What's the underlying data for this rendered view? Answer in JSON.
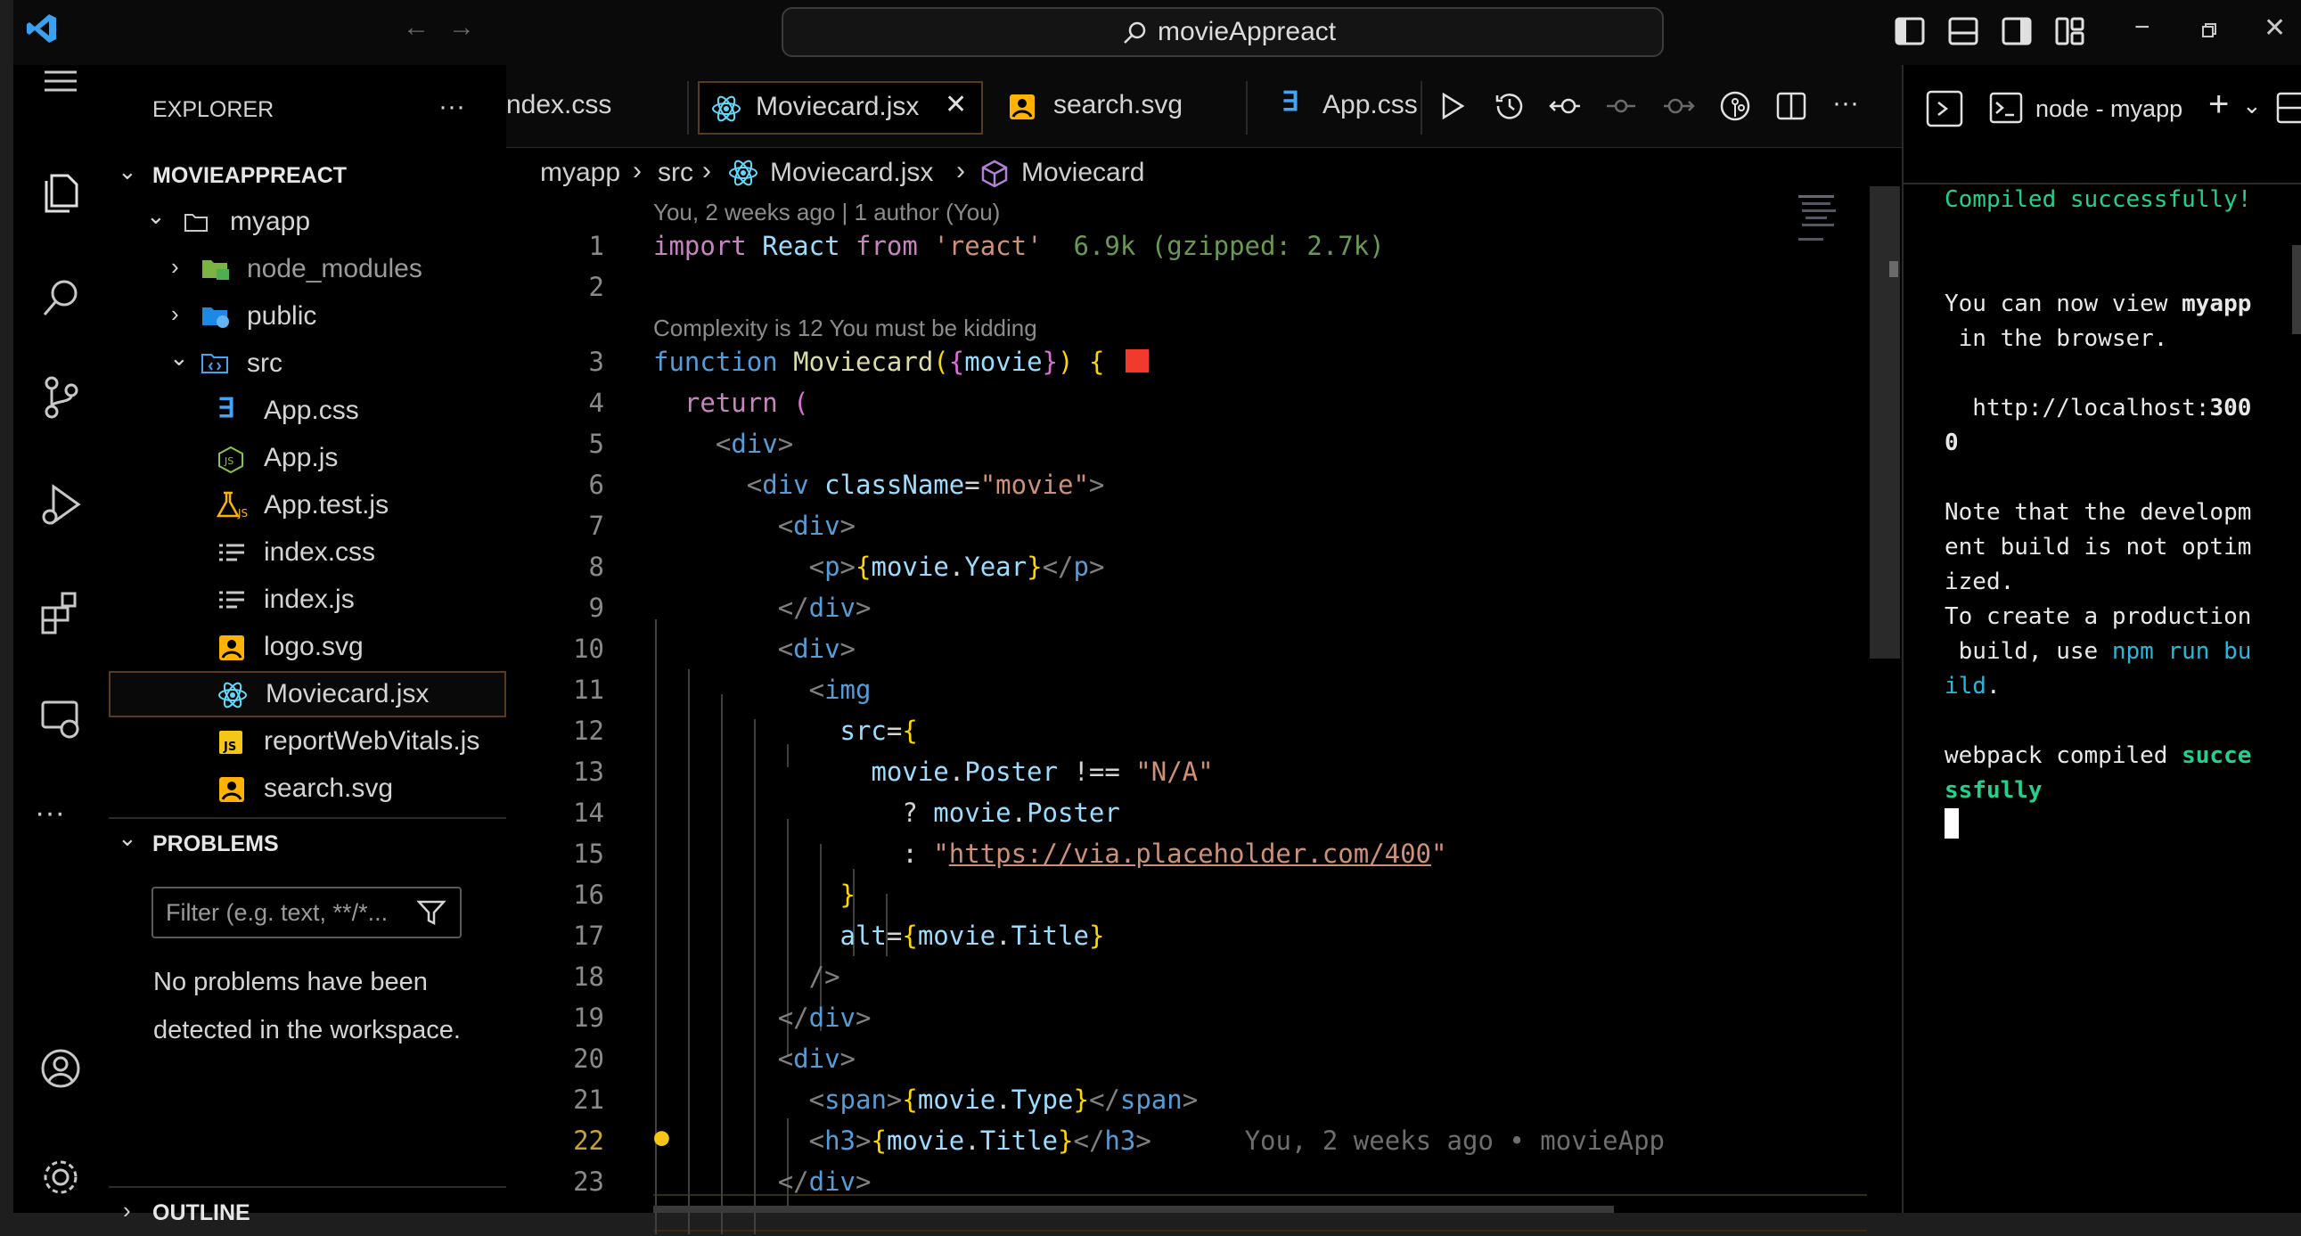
{
  "titlebar": {
    "search_text": "movieAppreact"
  },
  "sidebar": {
    "header": "EXPLORER",
    "more": "···",
    "root": "MOVIEAPPREACT",
    "tree": [
      {
        "label": "myapp",
        "kind": "folder-open",
        "indent": 1
      },
      {
        "label": "node_modules",
        "kind": "folder-node",
        "indent": 2
      },
      {
        "label": "public",
        "kind": "folder-public",
        "indent": 2
      },
      {
        "label": "src",
        "kind": "folder-src",
        "indent": 2
      },
      {
        "label": "App.css",
        "kind": "css",
        "indent": 3
      },
      {
        "label": "App.js",
        "kind": "js",
        "indent": 3
      },
      {
        "label": "App.test.js",
        "kind": "test",
        "indent": 3
      },
      {
        "label": "index.css",
        "kind": "text",
        "indent": 3
      },
      {
        "label": "index.js",
        "kind": "text",
        "indent": 3
      },
      {
        "label": "logo.svg",
        "kind": "svg",
        "indent": 3
      },
      {
        "label": "Moviecard.jsx",
        "kind": "react",
        "indent": 3,
        "selected": true
      },
      {
        "label": "reportWebVitals.js",
        "kind": "js-yellow",
        "indent": 3
      },
      {
        "label": "search.svg",
        "kind": "svg",
        "indent": 3
      }
    ],
    "problems_header": "PROBLEMS",
    "filter_placeholder": "Filter (e.g. text, **/*...",
    "problems_message": [
      "No problems have been",
      "detected in the workspace."
    ],
    "outline_header": "OUTLINE"
  },
  "tabs": [
    {
      "label": "ndex.css",
      "icon": "text"
    },
    {
      "label": "Moviecard.jsx",
      "icon": "react",
      "active": true
    },
    {
      "label": "search.svg",
      "icon": "svg"
    },
    {
      "label": "App.css",
      "icon": "css"
    }
  ],
  "breadcrumb": [
    "myapp",
    "src",
    "Moviecard.jsx",
    "Moviecard"
  ],
  "editor": {
    "codelens_blame": "You, 2 weeks ago | 1 author (You)",
    "import_cost": "6.9k (gzipped: 2.7k)",
    "codelens_complexity": "Complexity is 12 You must be kidding",
    "inline_blame": "You, 2 weeks ago • movieApp",
    "current_line": 22,
    "line_numbers": [
      "1",
      "2",
      "3",
      "4",
      "5",
      "6",
      "7",
      "8",
      "9",
      "10",
      "11",
      "12",
      "13",
      "14",
      "15",
      "16",
      "17",
      "18",
      "19",
      "20",
      "21",
      "22",
      "23"
    ]
  },
  "terminal": {
    "tab_label": "node - myapp",
    "lines": {
      "compiled": "Compiled successfully!",
      "view1": "You can now view ",
      "view_app": "myapp",
      "view2": " in the browser.",
      "url1": "  http://localhost:",
      "url_port": "300",
      "url2": "0",
      "note1": "Note that the developm",
      "note2": "ent build is not optim",
      "note3": "ized.",
      "prod1": "To create a production",
      "prod2": " build, use ",
      "prod_cmd": "npm run bu",
      "prod3": "ild",
      "prod4": ".",
      "wp1": "webpack compiled ",
      "wp_succ1": "succe",
      "wp_succ2": "ssfully"
    }
  },
  "colors": {
    "accent": "#007acc",
    "background": "#000000",
    "selection_border": "#5a3a1a"
  }
}
